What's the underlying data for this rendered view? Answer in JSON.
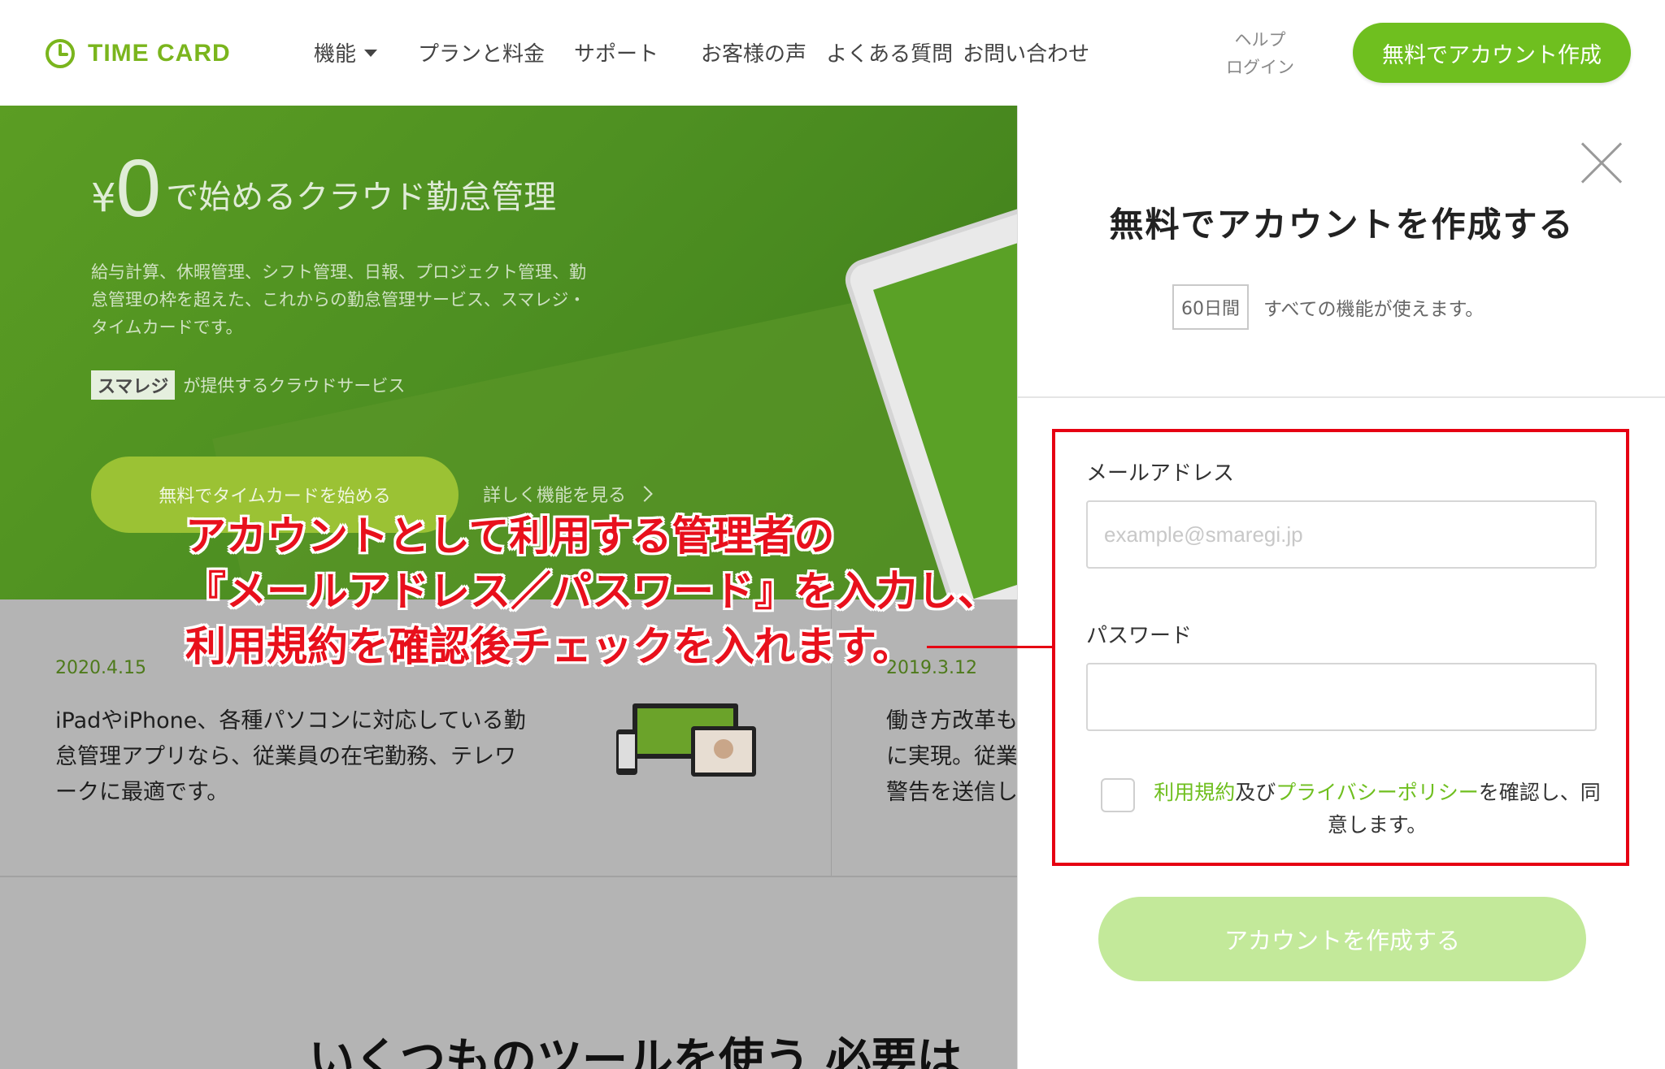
{
  "header": {
    "logo_text": "TIME CARD",
    "nav": {
      "features": "機能",
      "plans": "プランと料金",
      "support": "サポート",
      "voice": "お客様の声",
      "faq": "よくある質問",
      "contact": "お問い合わせ"
    },
    "help": "ヘルプ",
    "login": "ログイン",
    "signup_button": "無料でアカウント作成",
    "accent_color": "#6fbf1f"
  },
  "hero": {
    "price_symbol": "¥",
    "price_value": "0",
    "title": "で始めるクラウド勤怠管理",
    "description": "給与計算、休暇管理、シフト管理、日報、プロジェクト管理、勤怠管理の枠を超えた、これからの勤怠管理サービス、スマレジ・タイムカードです。",
    "brand_badge": "スマレジ",
    "brand_text": "が提供するクラウドサービス",
    "start_button": "無料でタイムカードを始める",
    "more_link": "詳しく機能を見る"
  },
  "news": [
    {
      "date": "2020.4.15",
      "text": "iPadやiPhone、各種パソコンに対応している勤怠管理アプリなら、従業員の在宅勤務、テレワークに最適です。"
    },
    {
      "date": "2019.3.12",
      "text": "働き方改革も\nに実現。従業\n警告を送信し"
    }
  ],
  "section_heading": "いくつものツールを使う 必要は",
  "modal": {
    "title": "無料でアカウントを作成する",
    "trial_badge": "60日間",
    "trial_text": "すべての機能が使えます。",
    "email_label": "メールアドレス",
    "email_placeholder": "example@smaregi.jp",
    "email_value": "",
    "password_label": "パスワード",
    "password_value": "",
    "terms_link": "利用規約",
    "terms_and": "及び",
    "privacy_link": "プライバシーポリシー",
    "terms_suffix": "を確認し、同意します。",
    "terms_checked": false,
    "create_button": "アカウントを作成する"
  },
  "annotation": {
    "line1": "アカウントとして利用する管理者の",
    "line2": "『メールアドレス／パスワード』を入力し、",
    "line3": "利用規約を確認後チェックを入れます。",
    "color": "#e60012"
  }
}
